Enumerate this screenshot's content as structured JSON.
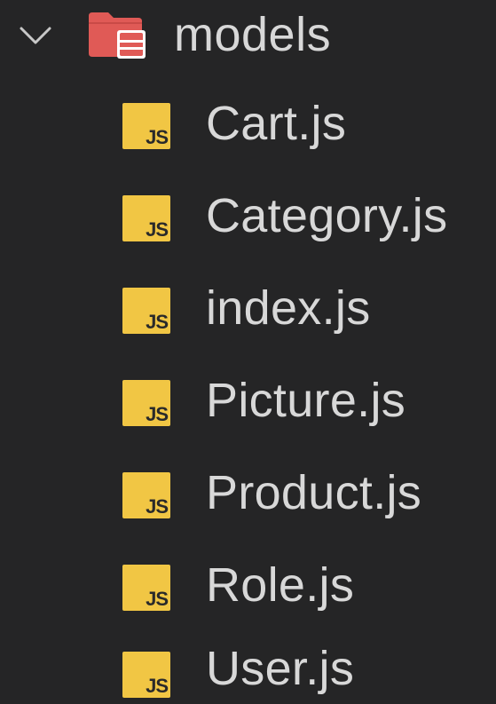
{
  "explorer": {
    "folder": {
      "label": "models",
      "expanded": true,
      "icon": "chevron-down-icon",
      "folder_icon": "folder-database-icon",
      "folder_color": "#e05a56"
    },
    "files": [
      {
        "label": "Cart.js",
        "icon": "js-file-icon"
      },
      {
        "label": "Category.js",
        "icon": "js-file-icon"
      },
      {
        "label": "index.js",
        "icon": "js-file-icon"
      },
      {
        "label": "Picture.js",
        "icon": "js-file-icon"
      },
      {
        "label": "Product.js",
        "icon": "js-file-icon"
      },
      {
        "label": "Role.js",
        "icon": "js-file-icon"
      },
      {
        "label": "User.js",
        "icon": "js-file-icon"
      }
    ],
    "js_badge_text": "JS",
    "js_badge_color": "#f1c644",
    "background": "#252526",
    "text_color": "#d8d8d8"
  }
}
